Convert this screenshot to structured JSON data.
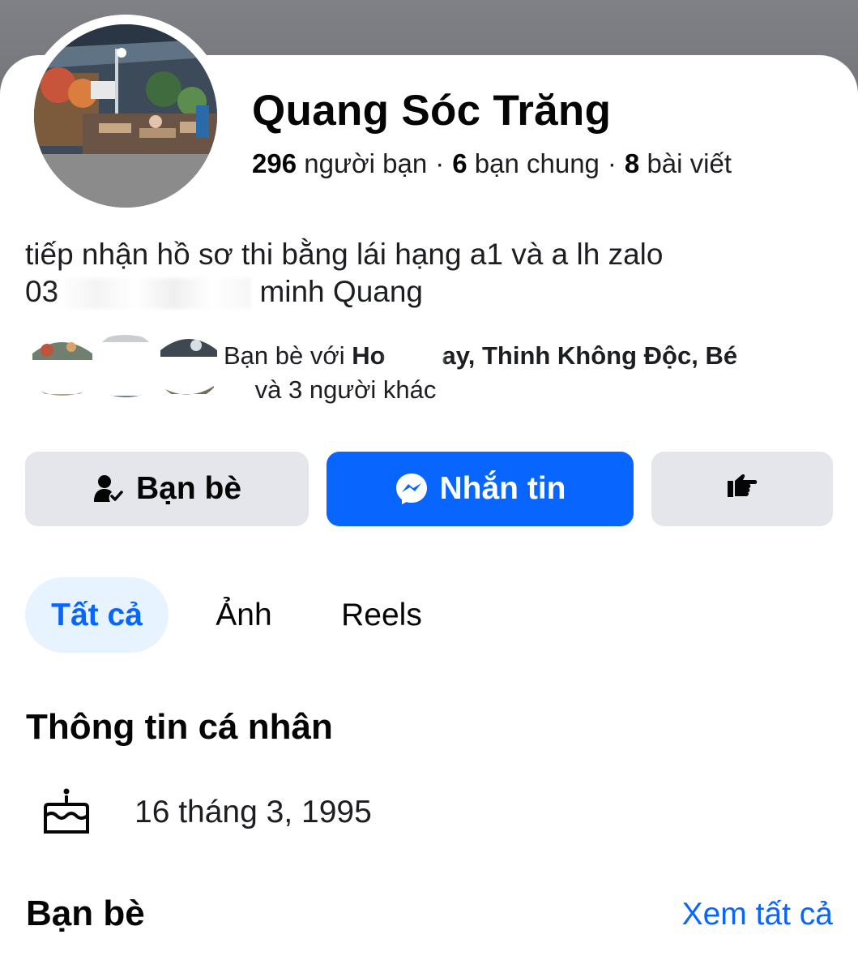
{
  "profile": {
    "name": "Quang Sóc Trăng",
    "stats": {
      "friends_count": "296",
      "friends_label": "người bạn",
      "mutual_count": "6",
      "mutual_label": "bạn chung",
      "posts_count": "8",
      "posts_label": "bài viết",
      "separator": "·"
    },
    "bio_line1": "tiếp nhận hồ sơ thi bằng lái hạng a1 và a lh zalo",
    "bio_prefix": "03",
    "bio_suffix": "minh Quang"
  },
  "mutual_friends": {
    "prefix": "Bạn bè với",
    "name_start": "Ho",
    "visible_fragment": "ay, Thinh Không Độc, Bé",
    "suffix": "và 3 người khác"
  },
  "actions": {
    "friends_label": "Bạn bè",
    "message_label": "Nhắn tin"
  },
  "tabs": [
    {
      "label": "Tất cả",
      "active": true
    },
    {
      "label": "Ảnh",
      "active": false
    },
    {
      "label": "Reels",
      "active": false
    }
  ],
  "about": {
    "title": "Thông tin cá nhân",
    "birthday": "16 tháng 3, 1995"
  },
  "friends_section": {
    "title": "Bạn bè",
    "see_all": "Xem tất cả"
  },
  "colors": {
    "accent": "#0866ff",
    "button_gray": "#e4e6eb",
    "active_tab_bg": "#e7f3ff"
  },
  "icons": {
    "friends": "person-check-icon",
    "message": "messenger-icon",
    "more": "pointing-hand-icon",
    "birthday": "birthday-cake-icon"
  }
}
